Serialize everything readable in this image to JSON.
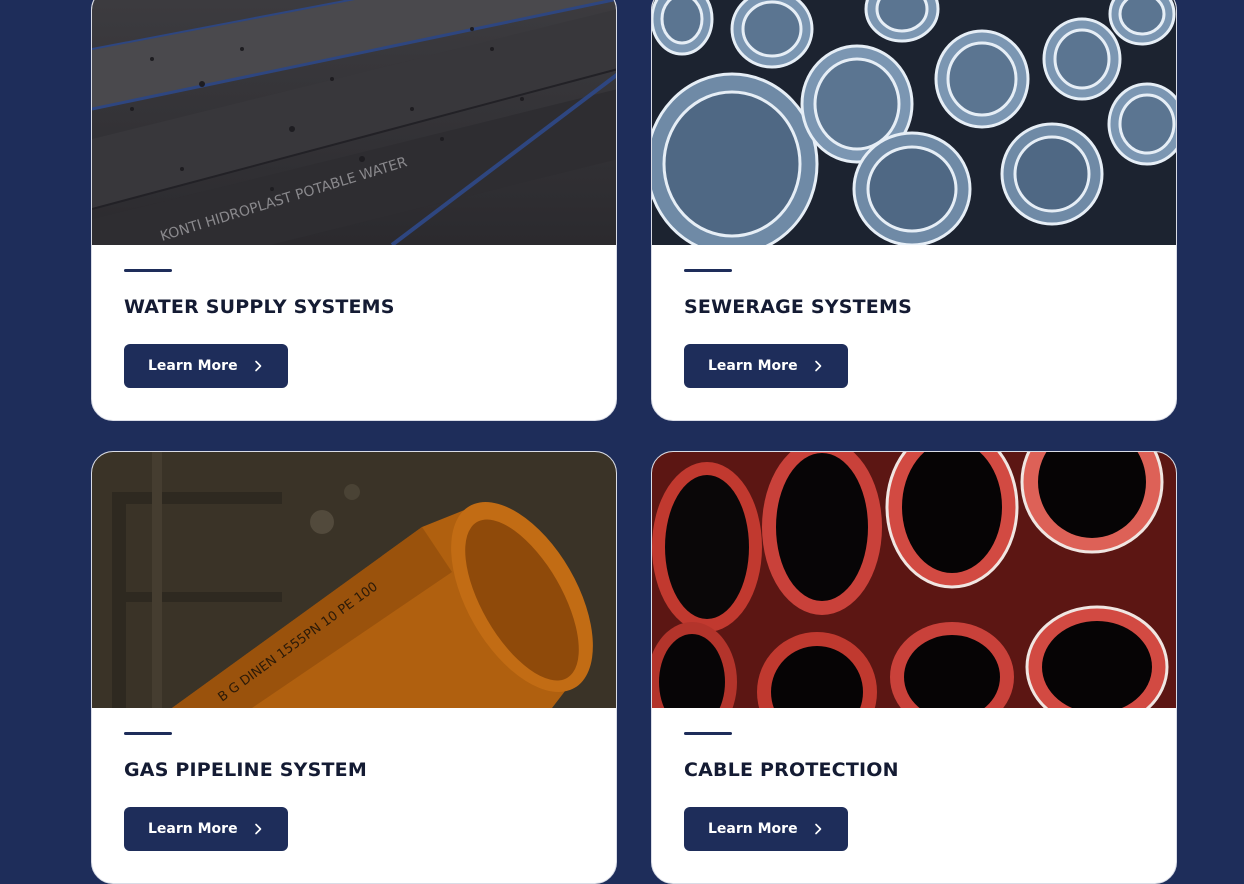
{
  "cards": [
    {
      "title": "WATER SUPPLY SYSTEMS",
      "button_label": "Learn More",
      "image": "black-hdpe-water-pipes-with-blue-stripes",
      "image_text": "KONTI HIDROPLAST POTABLE WATER"
    },
    {
      "title": "SEWERAGE SYSTEMS",
      "button_label": "Learn More",
      "image": "stacked-corrugated-sewer-pipes"
    },
    {
      "title": "GAS PIPELINE SYSTEM",
      "button_label": "Learn More",
      "image": "orange-gas-pipe",
      "image_text": "B G DINEN 1555PN 10 PE 100"
    },
    {
      "title": "CABLE PROTECTION",
      "button_label": "Learn More",
      "image": "red-corrugated-cable-conduits"
    }
  ],
  "colors": {
    "page_background": "#1e2d5a",
    "button_background": "#1e2d5a",
    "title_text": "#141b33"
  },
  "icons": {
    "button": "chevron-right-icon"
  }
}
